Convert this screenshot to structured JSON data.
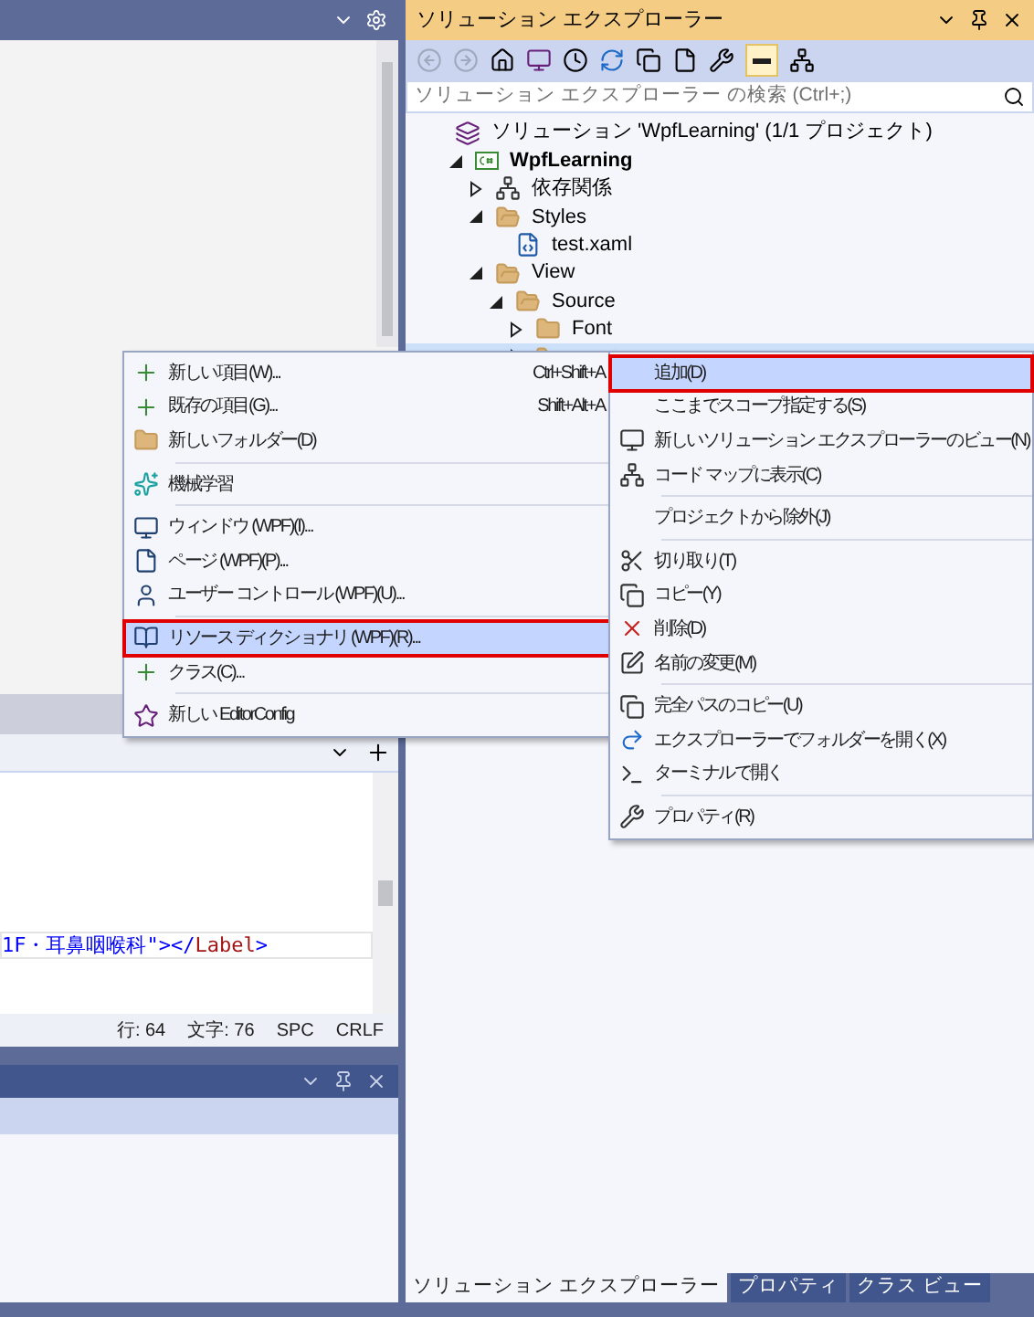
{
  "solution_explorer": {
    "title": "ソリューション エクスプローラー",
    "search": {
      "placeholder": "ソリューション エクスプローラー の検索 (Ctrl+;)"
    },
    "tree": [
      {
        "label": "ソリューション 'WpfLearning' (1/1 プロジェクト)",
        "kind": "solution",
        "selected": false,
        "children": [
          {
            "label": "WpfLearning",
            "kind": "project",
            "expanded": true,
            "selected": false,
            "children": [
              {
                "label": "依存関係",
                "kind": "deps",
                "expanded": false,
                "selected": false
              },
              {
                "label": "Styles",
                "kind": "folder",
                "expanded": true,
                "selected": false,
                "children": [
                  {
                    "label": "test.xaml",
                    "kind": "file",
                    "selected": false
                  }
                ]
              },
              {
                "label": "View",
                "kind": "folder",
                "expanded": true,
                "selected": false,
                "children": [
                  {
                    "label": "Source",
                    "kind": "folder",
                    "expanded": true,
                    "selected": false,
                    "children": [
                      {
                        "label": "Font",
                        "kind": "folder",
                        "expanded": false,
                        "selected": false
                      },
                      {
                        "kind": "folder",
                        "expanded": false,
                        "selected": true
                      }
                    ]
                  }
                ]
              }
            ]
          }
        ]
      }
    ],
    "tabs": [
      {
        "label": "ソリューション エクスプローラー",
        "selected": true
      },
      {
        "label": "プロパティ",
        "selected": false
      },
      {
        "label": "クラス ビュー",
        "selected": false
      }
    ]
  },
  "editor": {
    "code_line": [
      {
        "text": "1F・耳鼻咽喉科\"",
        "kind": "value"
      },
      {
        "text": "></",
        "kind": "punct"
      },
      {
        "text": "Label",
        "kind": "tag"
      },
      {
        "text": ">",
        "kind": "punct"
      }
    ],
    "status": [
      "行: 64",
      "文字: 76",
      "SPC",
      "CRLF"
    ]
  },
  "context_menu": [
    {
      "kind": "item",
      "label": "追加(D)",
      "highlighted": true
    },
    {
      "kind": "item",
      "label": "ここまでスコープ指定する(S)",
      "highlighted": false
    },
    {
      "kind": "item",
      "label": "新しいソリューション エクスプローラーのビュー(N)",
      "highlighted": false
    },
    {
      "kind": "item",
      "label": "コード マップに表示(C)",
      "highlighted": false
    },
    {
      "kind": "separator"
    },
    {
      "kind": "item",
      "label": "プロジェクトから除外(J)",
      "highlighted": false
    },
    {
      "kind": "separator"
    },
    {
      "kind": "item",
      "label": "切り取り(T)",
      "highlighted": false
    },
    {
      "kind": "item",
      "label": "コピー(Y)",
      "highlighted": false
    },
    {
      "kind": "item",
      "label": "削除(D)",
      "highlighted": false
    },
    {
      "kind": "item",
      "label": "名前の変更(M)",
      "highlighted": false
    },
    {
      "kind": "separator"
    },
    {
      "kind": "item",
      "label": "完全パスのコピー(U)",
      "highlighted": false
    },
    {
      "kind": "item",
      "label": "エクスプローラーでフォルダーを開く(X)",
      "highlighted": false
    },
    {
      "kind": "item",
      "label": "ターミナルで開く",
      "highlighted": false
    },
    {
      "kind": "separator"
    },
    {
      "kind": "item",
      "label": "プロパティ(R)",
      "highlighted": false
    }
  ],
  "add_submenu": [
    {
      "kind": "item",
      "label": "新しい項目(W)...",
      "shortcut": "Ctrl+Shift+A",
      "highlighted": false
    },
    {
      "kind": "item",
      "label": "既存の項目(G)...",
      "shortcut": "Shift+Alt+A",
      "highlighted": false
    },
    {
      "kind": "item",
      "label": "新しいフォルダー(D)",
      "highlighted": false
    },
    {
      "kind": "separator"
    },
    {
      "kind": "item",
      "label": "機械学習",
      "highlighted": false
    },
    {
      "kind": "separator"
    },
    {
      "kind": "item",
      "label": "ウィンドウ (WPF)(I)...",
      "highlighted": false
    },
    {
      "kind": "item",
      "label": "ページ (WPF)(P)...",
      "highlighted": false
    },
    {
      "kind": "item",
      "label": "ユーザー コントロール (WPF)(U)...",
      "highlighted": false
    },
    {
      "kind": "separator"
    },
    {
      "kind": "item",
      "label": "リソース ディクショナリ (WPF)(R)...",
      "highlighted": true
    },
    {
      "kind": "item",
      "label": "クラス(C)...",
      "highlighted": false
    },
    {
      "kind": "separator"
    },
    {
      "kind": "item",
      "label": "新しい EditorConfig",
      "highlighted": false
    }
  ]
}
